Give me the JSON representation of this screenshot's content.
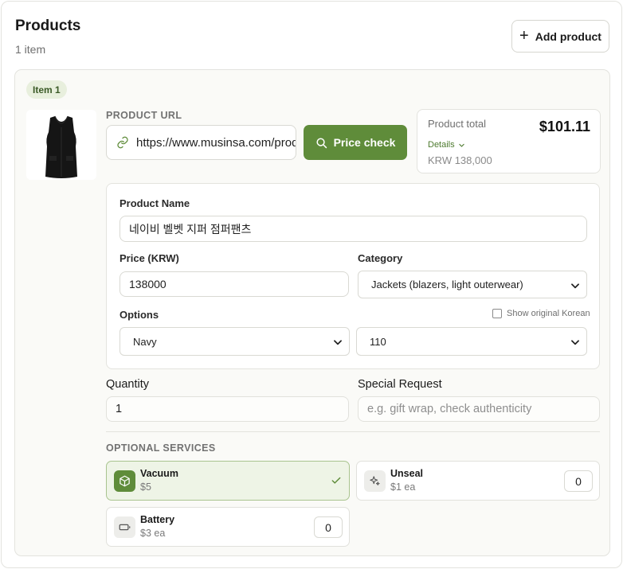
{
  "header": {
    "title": "Products",
    "count_label": "1 item",
    "add_button_label": "Add product"
  },
  "item": {
    "badge": "Item 1",
    "url_section_label": "PRODUCT URL",
    "url_value": "https://www.musinsa.com/products/",
    "price_check_label": "Price check",
    "total": {
      "label": "Product total",
      "value": "$101.11",
      "details_label": "Details",
      "krw_label": "KRW 138,000"
    },
    "form": {
      "name_label": "Product Name",
      "name_value": "네이비 벨벳 지퍼 점퍼팬츠",
      "price_label": "Price (KRW)",
      "price_value": "138000",
      "category_label": "Category",
      "category_value": "Jackets (blazers, light outerwear)",
      "options_label": "Options",
      "show_korean_label": "Show original Korean",
      "show_korean_checked": false,
      "option1_value": "Navy",
      "option2_value": "110"
    },
    "quantity_label": "Quantity",
    "quantity_value": "1",
    "special_request_label": "Special Request",
    "special_request_placeholder": "e.g. gift wrap, check authenticity",
    "services_label": "OPTIONAL SERVICES",
    "services": [
      {
        "name": "Vacuum",
        "price": "$5",
        "icon": "package-icon",
        "selected": true
      },
      {
        "name": "Unseal",
        "price": "$1 ea",
        "icon": "sparkle-icon",
        "count": "0"
      },
      {
        "name": "Battery",
        "price": "$3 ea",
        "icon": "battery-icon",
        "count": "0"
      }
    ]
  },
  "colors": {
    "accent": "#5f8c3a",
    "accent_light": "#eef4e6",
    "badge_bg": "#e8efdd"
  }
}
